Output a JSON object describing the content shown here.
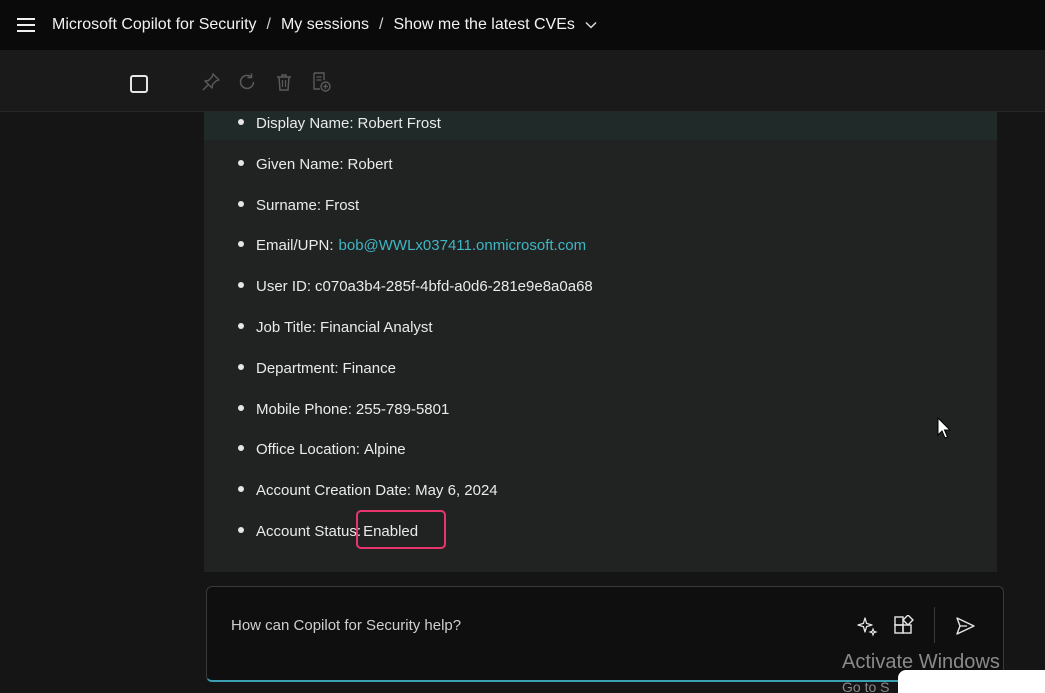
{
  "header": {
    "breadcrumb": [
      "Microsoft Copilot for Security",
      "My sessions",
      "Show me the latest CVEs"
    ],
    "separator": "/"
  },
  "toolbar": {
    "icons": [
      "checkbox-icon",
      "pin-icon",
      "refresh-icon",
      "delete-icon",
      "add-pinboard-icon"
    ]
  },
  "response": {
    "items": [
      {
        "label": "Display Name:",
        "value": "Robert Frost"
      },
      {
        "label": "Given Name:",
        "value": "Robert"
      },
      {
        "label": "Surname:",
        "value": "Frost"
      },
      {
        "label": "Email/UPN:",
        "value": "bob@WWLx037411.onmicrosoft.com",
        "is_link": true
      },
      {
        "label": "User ID:",
        "value": "c070a3b4-285f-4bfd-a0d6-281e9e8a0a68"
      },
      {
        "label": "Job Title:",
        "value": "Financial Analyst"
      },
      {
        "label": "Department:",
        "value": "Finance"
      },
      {
        "label": "Mobile Phone:",
        "value": "255-789-5801"
      },
      {
        "label": "Office Location:",
        "value": "Alpine"
      },
      {
        "label": "Account Creation Date:",
        "value": "May 6, 2024"
      },
      {
        "label": "Account Status:",
        "value": "Enabled",
        "highlighted": true
      }
    ]
  },
  "composer": {
    "placeholder": "How can Copilot for Security help?"
  },
  "watermark": {
    "title": "Activate Windows",
    "subtitle": "Go to S"
  },
  "colors": {
    "link": "#3fb6c4",
    "highlight": "#e8356d",
    "accent_line": "#3a9fb0"
  }
}
